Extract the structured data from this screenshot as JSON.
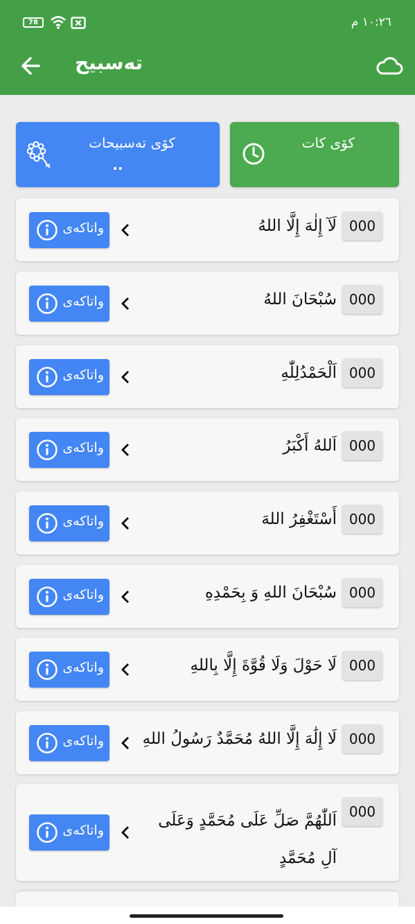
{
  "status_bar": {
    "time": "١٠:٢٦ م",
    "battery": "78"
  },
  "header": {
    "title": "تەسبیح",
    "bg_color": "#44a047"
  },
  "cards": {
    "tasbih_library": {
      "label": "كۆی تەسبیحات",
      "value": "..",
      "color": "#4386f4"
    },
    "total_count": {
      "label": "كۆی كات",
      "color": "#4caa50"
    }
  },
  "meaning_label": "واتاکەی",
  "zikr": [
    {
      "text": "لَآ إِلٰهَ إِلَّا اللهُ",
      "count": "000"
    },
    {
      "text": "سُبْحَانَ اللهُ",
      "count": "000"
    },
    {
      "text": "اَلْحَمْدُلِلّٰهِ",
      "count": "000"
    },
    {
      "text": "اَللهُ أَكْبَرُ",
      "count": "000"
    },
    {
      "text": "أَسْتَغْفِرُ اللهَ",
      "count": "000"
    },
    {
      "text": "سُبْحَانَ اللهِ وَ بِحَمْدِهِ",
      "count": "000"
    },
    {
      "text": "لَا حَوْلَ وَلَا قُوَّةَ إِلَّا بِاللهِ",
      "count": "000"
    },
    {
      "text": "لَا إِلَٰهَ إِلَّا اللهُ مُحَمَّدٌ رَسُولُ اللهِ",
      "count": "000"
    },
    {
      "text": "اَللّٰهُمَّ صَلِّ عَلَى مُحَمَّدٍ وَعَلَى آلِ مُحَمَّدٍ",
      "count": "000"
    }
  ]
}
